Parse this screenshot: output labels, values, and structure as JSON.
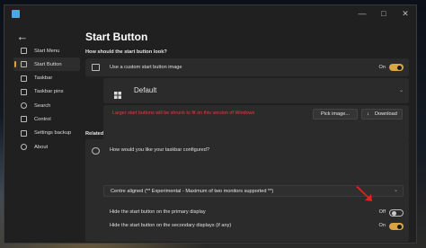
{
  "window": {
    "controls": [
      "—",
      "□",
      "✕"
    ]
  },
  "sidebar": {
    "items": [
      {
        "label": "Start Menu",
        "icon": "start-menu-icon"
      },
      {
        "label": "Start Button",
        "icon": "start-button-icon",
        "active": true
      },
      {
        "label": "Taskbar",
        "icon": "taskbar-icon"
      },
      {
        "label": "Taskbar pins",
        "icon": "taskbar-pins-icon"
      },
      {
        "label": "Search",
        "icon": "search-icon"
      },
      {
        "label": "Control",
        "icon": "control-icon"
      },
      {
        "label": "Settings backup",
        "icon": "settings-backup-icon"
      },
      {
        "label": "About",
        "icon": "about-icon"
      }
    ]
  },
  "main": {
    "title": "Start Button",
    "question": "How should the start button look?",
    "custom_image": {
      "label": "Use a custom start button image",
      "state": "On"
    },
    "image_name": "Default",
    "warning": "Larger start buttons will be shrunk to fit on this version of Windows",
    "pick_image_label": "Pick image...",
    "download_label": "Download",
    "related_label": "Related",
    "taskbar_question": "How would you like your taskbar configured?",
    "taskbar_option": "Centre aligned (** Experimental - Maximum of two monitors supported **)",
    "primary_hide": {
      "label": "Hide the start button on the primary display",
      "state": "Off"
    },
    "secondary_hide": {
      "label": "Hide the start button on the secondary displays (if any)",
      "state": "On"
    }
  },
  "colors": {
    "accent": "#d9a441",
    "warning": "#e0413a",
    "annotation_arrow": "#e3201b"
  }
}
